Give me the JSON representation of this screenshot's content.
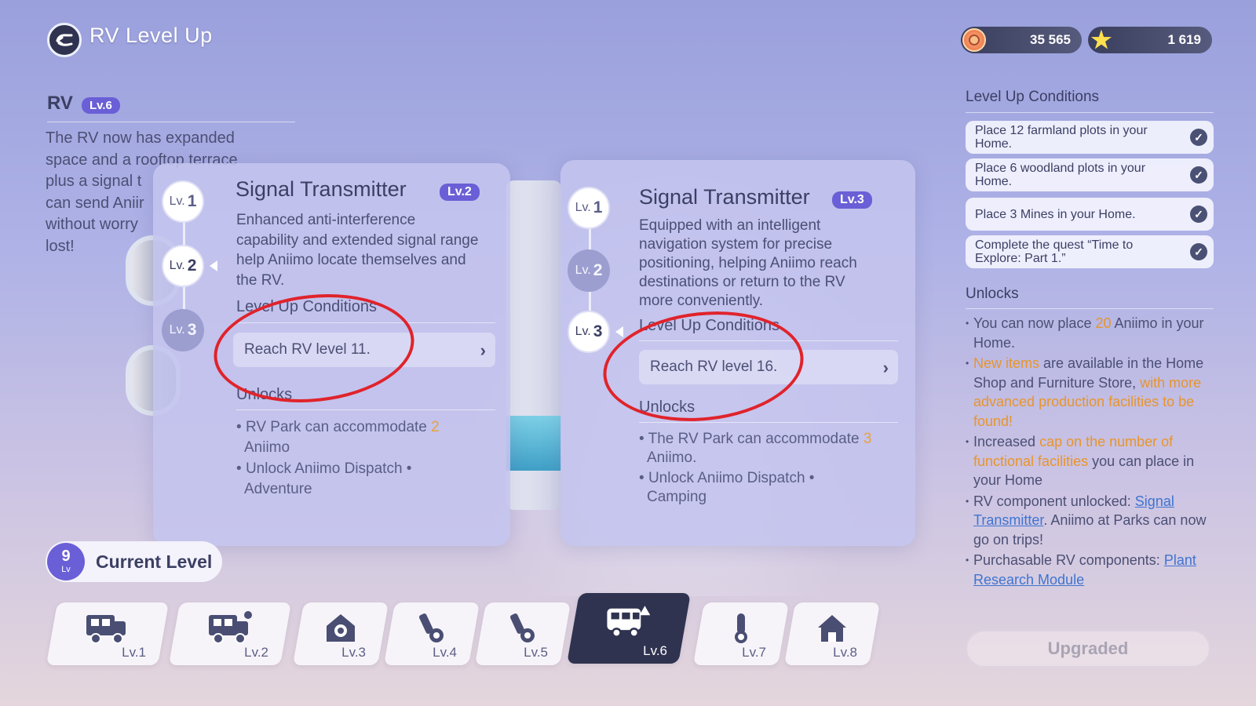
{
  "header": {
    "title": "RV Level Up"
  },
  "currencies": [
    {
      "icon": "gold-coin-icon",
      "value": "35 565"
    },
    {
      "icon": "star-icon",
      "value": "1 619"
    }
  ],
  "rv": {
    "label": "RV",
    "level_badge": "Lv.6",
    "description": "The RV now has expanded space and a rooftop terrace, plus a signal t... can send Anii... without worry... lost!"
  },
  "rv_desc_lines": [
    "The RV now has expanded",
    "space and a rooftop terrace",
    "plus a signal t",
    "can send Aniir",
    "without worry",
    "lost!"
  ],
  "card1": {
    "title": "Signal Transmitter",
    "badge": "Lv.2",
    "levels": [
      "1",
      "2",
      "3"
    ],
    "lv_prefix": "Lv.",
    "description_lines": [
      "Enhanced anti-interference",
      "capability and extended signal range",
      "help Aniimo locate themselves and",
      "the RV."
    ],
    "conditions_head": "Level Up Conditions",
    "condition": "Reach RV level 11.",
    "unlocks_head": "Unlocks",
    "unlock1_pre": "RV Park can accommodate ",
    "unlock1_num": "2",
    "unlock1_post": "Aniimo",
    "unlock2_line1": "Unlock Aniimo Dispatch  •",
    "unlock2_line2": "Adventure"
  },
  "card2": {
    "title": "Signal Transmitter",
    "badge": "Lv.3",
    "levels": [
      "1",
      "2",
      "3"
    ],
    "lv_prefix": "Lv.",
    "description_lines": [
      "Equipped with an intelligent",
      "navigation system for precise",
      "positioning, helping Aniimo reach",
      "destinations or return to the RV",
      "more conveniently."
    ],
    "conditions_head": "Level Up Conditions",
    "condition": "Reach RV level 16.",
    "unlocks_head": "Unlocks",
    "unlock1_pre": "The RV Park can accommodate ",
    "unlock1_num": "3",
    "unlock1_post": "Aniimo.",
    "unlock2_line1": "Unlock Aniimo Dispatch  •",
    "unlock2_line2": "Camping"
  },
  "right_panel": {
    "conditions_head": "Level Up Conditions",
    "conditions": [
      "Place 12 farmland plots in your Home.",
      "Place 6 woodland plots in your Home.",
      "Place 3 Mines in your Home.",
      "Complete the quest  “Time to Explore: Part 1.”"
    ],
    "unlocks_head": "Unlocks",
    "u1_a": "You can now place ",
    "u1_num": "20",
    "u1_b": " Aniimo in your Home.",
    "u2_hl": "New items",
    "u2_a": " are available in the Home Shop and Furniture Store, ",
    "u2_hl2": "with more advanced production facilities to be found!",
    "u3_a": "Increased ",
    "u3_hl": "cap on the number of functional facilities",
    "u3_b": " you can place in your Home",
    "u4_a": "RV component unlocked: ",
    "u4_link": "Signal Transmitter",
    "u4_b": ". Aniimo at Parks can now go on trips!",
    "u5_a": "Purchasable RV components: ",
    "u5_link": "Plant Research Module",
    "button": "Upgraded"
  },
  "current_level": {
    "number": "9",
    "unit": "Lv",
    "label": "Current Level"
  },
  "level_tiles": [
    {
      "label": "Lv.1",
      "icon": "rv-truck-icon"
    },
    {
      "label": "Lv.2",
      "icon": "rv-truck-pet-icon"
    },
    {
      "label": "Lv.3",
      "icon": "home-gear-icon"
    },
    {
      "label": "Lv.4",
      "icon": "bolt-nut-icon"
    },
    {
      "label": "Lv.5",
      "icon": "bolt-nut-icon"
    },
    {
      "label": "Lv.6",
      "icon": "rv-van-icon",
      "selected": true
    },
    {
      "label": "Lv.7",
      "icon": "thermometer-icon"
    },
    {
      "label": "Lv.8",
      "icon": "house-icon"
    }
  ]
}
